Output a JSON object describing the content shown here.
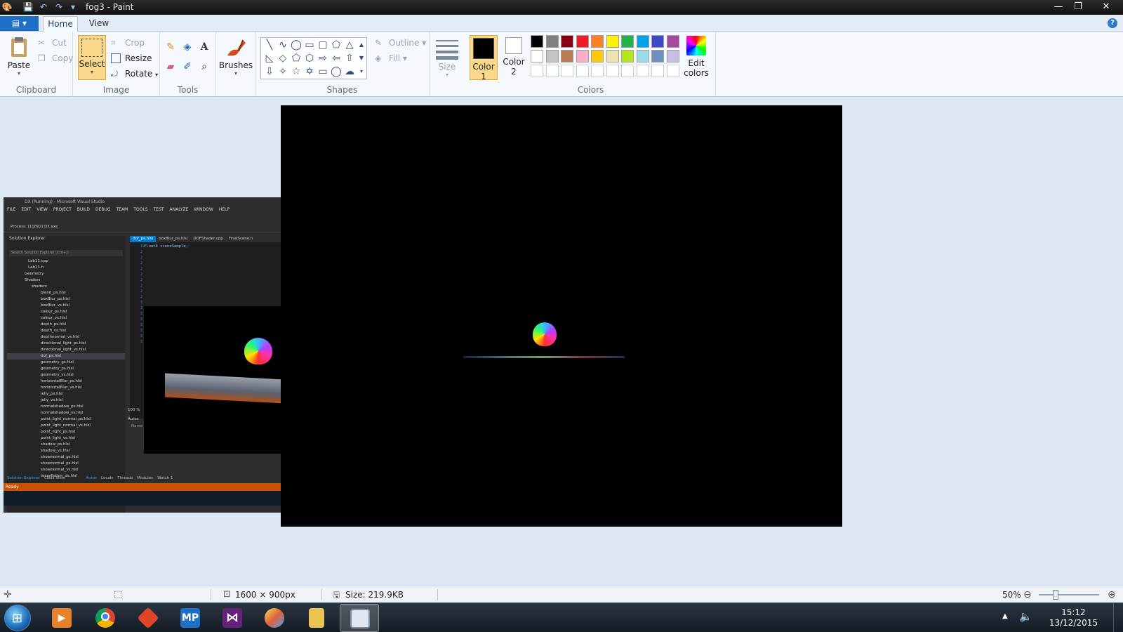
{
  "window": {
    "title": "fog3 - Paint",
    "controls": {
      "minimize": "—",
      "restore": "❐",
      "close": "✕"
    }
  },
  "quick_access": {
    "save": "💾",
    "undo": "↶",
    "redo": "↷",
    "customize": "▾"
  },
  "tabs": {
    "file": "▤ ▾",
    "home": "Home",
    "view": "View",
    "help": "?"
  },
  "ribbon": {
    "clipboard": {
      "paste": "Paste",
      "cut": "Cut",
      "copy": "Copy",
      "label": "Clipboard"
    },
    "image": {
      "select": "Select",
      "crop": "Crop",
      "resize": "Resize",
      "rotate": "Rotate",
      "label": "Image"
    },
    "tools": {
      "label": "Tools"
    },
    "brushes": {
      "label": "Brushes"
    },
    "shapes": {
      "outline": "Outline",
      "fill": "Fill",
      "label": "Shapes"
    },
    "size": {
      "label": "Size"
    },
    "colors": {
      "color1": "Color 1",
      "color2": "Color 2",
      "edit": "Edit colors",
      "label": "Colors",
      "palette_row1": [
        "#000000",
        "#7f7f7f",
        "#880015",
        "#ed1c24",
        "#ff7f27",
        "#fff200",
        "#22b14c",
        "#00a2e8",
        "#3f48cc",
        "#a349a4"
      ],
      "palette_row2": [
        "#ffffff",
        "#c3c3c3",
        "#b97a57",
        "#ffaec9",
        "#ffc90e",
        "#efe4b0",
        "#b5e61d",
        "#99d9ea",
        "#7092be",
        "#c8bfe7"
      ],
      "color1_value": "#000000",
      "color2_value": "#ffffff"
    }
  },
  "embedded_vs": {
    "title": "DX (Running) - Microsoft Visual Studio",
    "menu": [
      "FILE",
      "EDIT",
      "VIEW",
      "PROJECT",
      "BUILD",
      "DEBUG",
      "TEAM",
      "TOOLS",
      "TEST",
      "ANALYZE",
      "WINDOW",
      "HELP"
    ],
    "process": "Process: [11892] DX.exe",
    "solution_explorer": "Solution Explorer",
    "search": "Search Solution Explorer (Ctrl+;)",
    "files": [
      "Lab11.cpp",
      "Lab11.h",
      "Geometry",
      "Shaders",
      "shaders",
      "blend_ps.hlsl",
      "boxBlur_ps.hlsl",
      "boxBlur_vs.hlsl",
      "colour_ps.hlsl",
      "colour_vs.hlsl",
      "depth_ps.hlsl",
      "depth_vs.hlsl",
      "depthnormal_vs.hlsl",
      "directional_light_ps.hlsl",
      "directional_light_vs.hlsl",
      "dof_ps.hlsl",
      "geometry_gs.hlsl",
      "geometry_ps.hlsl",
      "geometry_vs.hlsl",
      "horizontalBlur_ps.hlsl",
      "horizontalBlur_vs.hlsl",
      "jelly_ps.hlsl",
      "jelly_vs.hlsl",
      "normalshadow_ps.hlsl",
      "normalshadow_vs.hlsl",
      "point_light_normal_ps.hlsl",
      "point_light_normal_vs.hlsl",
      "point_light_ps.hlsl",
      "point_light_vs.hlsl",
      "shadow_ps.hlsl",
      "shadow_vs.hlsl",
      "shownormal_gs.hlsl",
      "shownormal_ps.hlsl",
      "shownormal_vs.hlsl",
      "tessellation_ds.hlsl"
    ],
    "editor_tabs": [
      "dof_ps.hlsl",
      "boxBlur_ps.hlsl",
      "DOFShader.cpp",
      "FinalScene.h"
    ],
    "code_line": "float4 sceneSample;",
    "zoom": "100 %",
    "autos": "Autos",
    "name_col": "Name",
    "bottom_tabs": [
      "Solution Explorer",
      "Class View",
      "Autos",
      "Locals",
      "Threads",
      "Modules",
      "Watch 1"
    ],
    "status": "Ready"
  },
  "statusbar": {
    "dimensions": "1600 × 900px",
    "size": "Size: 219.9KB",
    "zoom": "50%"
  },
  "taskbar": {
    "apps": [
      "media-player",
      "chrome",
      "git",
      "MP",
      "visual-studio",
      "paint",
      "explorer",
      "window"
    ],
    "mp_label": "MP",
    "time": "15:12",
    "date": "13/12/2015"
  }
}
